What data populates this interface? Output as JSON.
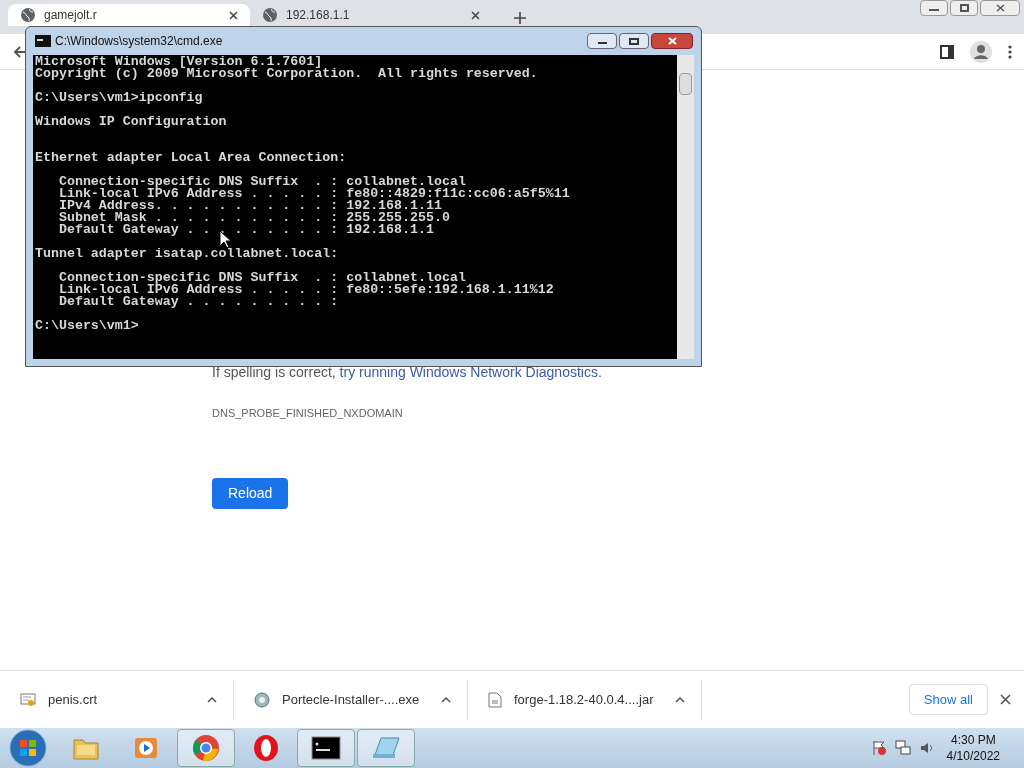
{
  "browser": {
    "tabs": [
      {
        "title": "gamejolt.r",
        "selected": true
      },
      {
        "title": "192.168.1.1",
        "selected": false
      }
    ]
  },
  "page": {
    "hint": "If spelling is correct, ",
    "hint_link": "try running Windows Network Diagnostics",
    "hint_end": ".",
    "error_code": "DNS_PROBE_FINISHED_NXDOMAIN",
    "reload_button": "Reload"
  },
  "console": {
    "title": "C:\\Windows\\system32\\cmd.exe",
    "blocks": [
      {
        "kind": "first",
        "lines": [
          "Microsoft Windows [Version 6.1.7601]",
          "Copyright (c) 2009 Microsoft Corporation.  All rights reserved."
        ]
      },
      {
        "kind": "block",
        "lines": [
          "C:\\Users\\vm1>ipconfig"
        ]
      },
      {
        "kind": "block",
        "lines": [
          "Windows IP Configuration"
        ]
      },
      {
        "kind": "wide",
        "lines": [
          "Ethernet adapter Local Area Connection:"
        ]
      },
      {
        "kind": "block",
        "lines": [
          "   Connection-specific DNS Suffix  . : collabnet.local",
          "   Link-local IPv6 Address . . . . . : fe80::4829:f11c:cc06:a5f5%11",
          "   IPv4 Address. . . . . . . . . . . : 192.168.1.11",
          "   Subnet Mask . . . . . . . . . . . : 255.255.255.0",
          "   Default Gateway . . . . . . . . . : 192.168.1.1"
        ]
      },
      {
        "kind": "block",
        "lines": [
          "Tunnel adapter isatap.collabnet.local:"
        ]
      },
      {
        "kind": "block",
        "lines": [
          "   Connection-specific DNS Suffix  . : collabnet.local",
          "   Link-local IPv6 Address . . . . . : fe80::5efe:192.168.1.11%12",
          "   Default Gateway . . . . . . . . . :"
        ]
      },
      {
        "kind": "block",
        "lines": [
          "C:\\Users\\vm1>"
        ]
      }
    ]
  },
  "downloads": {
    "items": [
      {
        "name": "penis.crt",
        "kind": "certificate"
      },
      {
        "name": "Portecle-Installer-....exe",
        "kind": "installer"
      },
      {
        "name": "forge-1.18.2-40.0.4....jar",
        "kind": "file"
      }
    ],
    "show_all": "Show all"
  },
  "taskbar": {
    "apps": [
      {
        "kind": "folder",
        "open": false
      },
      {
        "kind": "media",
        "open": false
      },
      {
        "kind": "chrome",
        "open": true
      },
      {
        "kind": "opera",
        "open": false
      },
      {
        "kind": "console",
        "open": true
      },
      {
        "kind": "notepad",
        "open": true
      }
    ],
    "time": "4:30 PM",
    "date": "4/10/2022"
  }
}
